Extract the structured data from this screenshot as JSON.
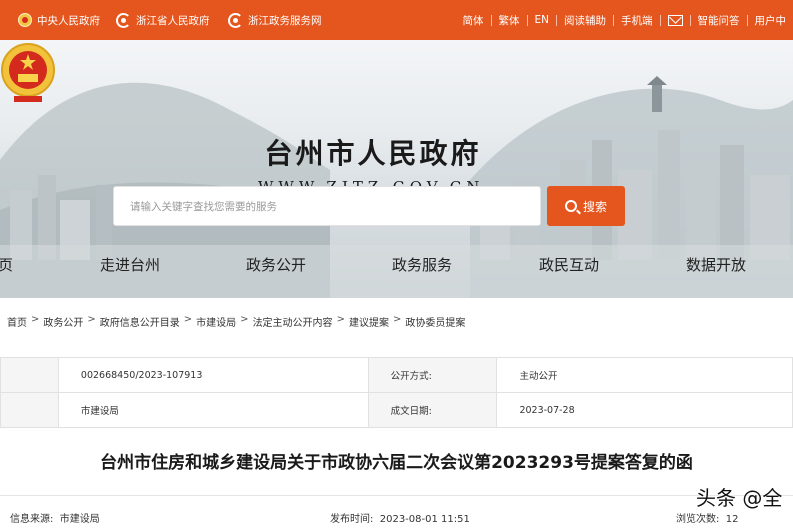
{
  "topbar": {
    "links": [
      "中央人民政府",
      "浙江省人民政府",
      "浙江政务服务网"
    ],
    "right": {
      "simplified": "简体",
      "traditional": "繁体",
      "english": "EN",
      "accessibility": "阅读辅助",
      "mobile": "手机端",
      "smart_qa": "智能问答",
      "user_center": "用户中"
    }
  },
  "banner": {
    "site_title": "台州市人民政府",
    "site_url": "WWW.ZJTZ.GOV.CN"
  },
  "search": {
    "placeholder": "请输入关键字查找您需要的服务",
    "button": "搜索"
  },
  "nav": [
    "页",
    "走进台州",
    "政务公开",
    "政务服务",
    "政民互动",
    "数据开放"
  ],
  "breadcrumb": [
    "首页",
    "政务公开",
    "政府信息公开目录",
    "市建设局",
    "法定主动公开内容",
    "建议提案",
    "政协委员提案"
  ],
  "info": {
    "index_no": "002668450/2023-107913",
    "publish_method_label": "公开方式:",
    "publish_method": "主动公开",
    "agency": "市建设局",
    "created_label": "成文日期:",
    "created_date": "2023-07-28"
  },
  "doc": {
    "title": "台州市住房和城乡建设局关于市政协六届二次会议第2023293号提案答复的函",
    "source_label": "信息来源:",
    "source": "市建设局",
    "publish_time_label": "发布时间:",
    "publish_time": "2023-08-01 11:51",
    "views_label": "浏览次数:",
    "views": "12"
  },
  "watermark": "头条 @全"
}
